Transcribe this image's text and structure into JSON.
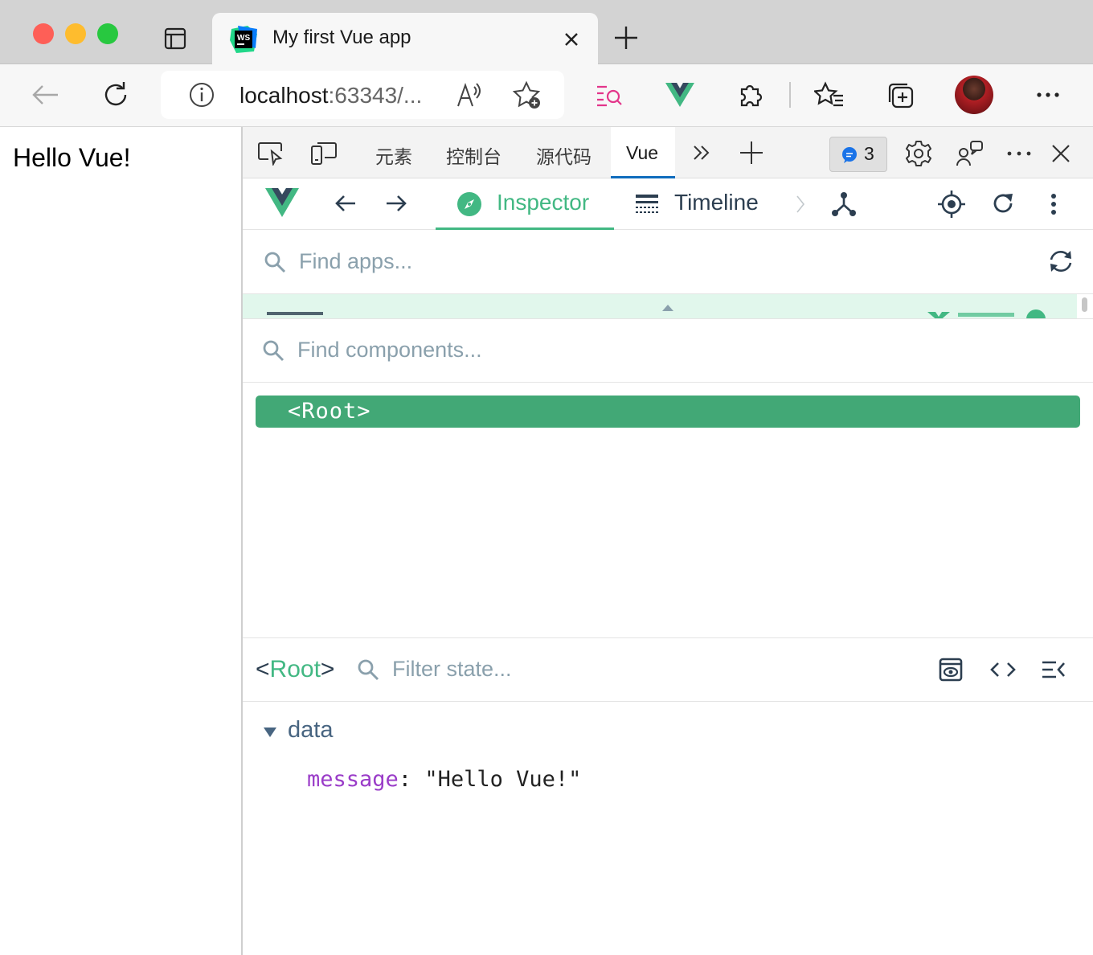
{
  "browser": {
    "tab_title": "My first Vue app",
    "url_host": "localhost",
    "url_rest": ":63343/..."
  },
  "page": {
    "text": "Hello Vue!"
  },
  "devtools": {
    "tabs": [
      "元素",
      "控制台",
      "源代码",
      "Vue"
    ],
    "active_tab": "Vue",
    "issues_count": "3"
  },
  "vue": {
    "nav": {
      "inspector": "Inspector",
      "timeline": "Timeline"
    },
    "find_apps_placeholder": "Find apps...",
    "find_components_placeholder": "Find components...",
    "root_node": "<Root>",
    "state": {
      "selected_prefix": "<",
      "selected_name": "Root",
      "selected_suffix": ">",
      "filter_placeholder": "Filter state...",
      "section": "data",
      "key": "message",
      "sep": ": ",
      "value": "\"Hello Vue!\""
    }
  },
  "colors": {
    "vue_green": "#42b883",
    "active_row": "#42a876",
    "edge_blue": "#0f6cbd"
  }
}
